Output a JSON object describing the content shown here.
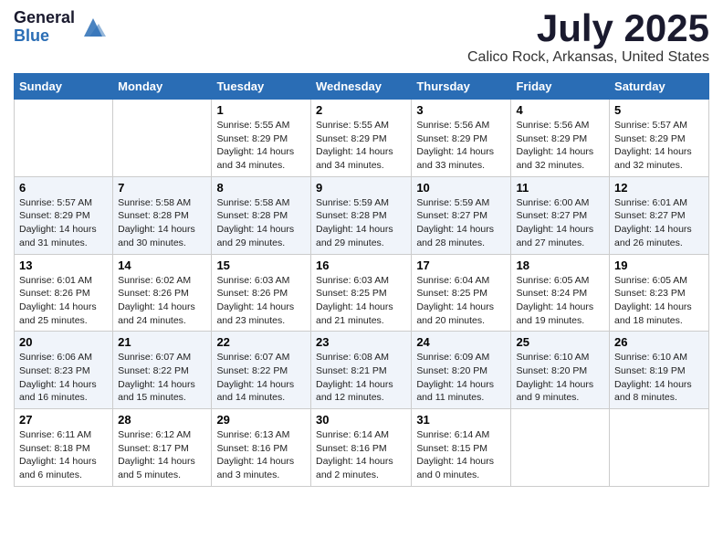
{
  "header": {
    "logo_general": "General",
    "logo_blue": "Blue",
    "month": "July 2025",
    "location": "Calico Rock, Arkansas, United States"
  },
  "days_of_week": [
    "Sunday",
    "Monday",
    "Tuesday",
    "Wednesday",
    "Thursday",
    "Friday",
    "Saturday"
  ],
  "weeks": [
    [
      {
        "day": "",
        "sunrise": "",
        "sunset": "",
        "daylight": "",
        "empty": true
      },
      {
        "day": "",
        "sunrise": "",
        "sunset": "",
        "daylight": "",
        "empty": true
      },
      {
        "day": "1",
        "sunrise": "Sunrise: 5:55 AM",
        "sunset": "Sunset: 8:29 PM",
        "daylight": "Daylight: 14 hours and 34 minutes."
      },
      {
        "day": "2",
        "sunrise": "Sunrise: 5:55 AM",
        "sunset": "Sunset: 8:29 PM",
        "daylight": "Daylight: 14 hours and 34 minutes."
      },
      {
        "day": "3",
        "sunrise": "Sunrise: 5:56 AM",
        "sunset": "Sunset: 8:29 PM",
        "daylight": "Daylight: 14 hours and 33 minutes."
      },
      {
        "day": "4",
        "sunrise": "Sunrise: 5:56 AM",
        "sunset": "Sunset: 8:29 PM",
        "daylight": "Daylight: 14 hours and 32 minutes."
      },
      {
        "day": "5",
        "sunrise": "Sunrise: 5:57 AM",
        "sunset": "Sunset: 8:29 PM",
        "daylight": "Daylight: 14 hours and 32 minutes."
      }
    ],
    [
      {
        "day": "6",
        "sunrise": "Sunrise: 5:57 AM",
        "sunset": "Sunset: 8:29 PM",
        "daylight": "Daylight: 14 hours and 31 minutes."
      },
      {
        "day": "7",
        "sunrise": "Sunrise: 5:58 AM",
        "sunset": "Sunset: 8:28 PM",
        "daylight": "Daylight: 14 hours and 30 minutes."
      },
      {
        "day": "8",
        "sunrise": "Sunrise: 5:58 AM",
        "sunset": "Sunset: 8:28 PM",
        "daylight": "Daylight: 14 hours and 29 minutes."
      },
      {
        "day": "9",
        "sunrise": "Sunrise: 5:59 AM",
        "sunset": "Sunset: 8:28 PM",
        "daylight": "Daylight: 14 hours and 29 minutes."
      },
      {
        "day": "10",
        "sunrise": "Sunrise: 5:59 AM",
        "sunset": "Sunset: 8:27 PM",
        "daylight": "Daylight: 14 hours and 28 minutes."
      },
      {
        "day": "11",
        "sunrise": "Sunrise: 6:00 AM",
        "sunset": "Sunset: 8:27 PM",
        "daylight": "Daylight: 14 hours and 27 minutes."
      },
      {
        "day": "12",
        "sunrise": "Sunrise: 6:01 AM",
        "sunset": "Sunset: 8:27 PM",
        "daylight": "Daylight: 14 hours and 26 minutes."
      }
    ],
    [
      {
        "day": "13",
        "sunrise": "Sunrise: 6:01 AM",
        "sunset": "Sunset: 8:26 PM",
        "daylight": "Daylight: 14 hours and 25 minutes."
      },
      {
        "day": "14",
        "sunrise": "Sunrise: 6:02 AM",
        "sunset": "Sunset: 8:26 PM",
        "daylight": "Daylight: 14 hours and 24 minutes."
      },
      {
        "day": "15",
        "sunrise": "Sunrise: 6:03 AM",
        "sunset": "Sunset: 8:26 PM",
        "daylight": "Daylight: 14 hours and 23 minutes."
      },
      {
        "day": "16",
        "sunrise": "Sunrise: 6:03 AM",
        "sunset": "Sunset: 8:25 PM",
        "daylight": "Daylight: 14 hours and 21 minutes."
      },
      {
        "day": "17",
        "sunrise": "Sunrise: 6:04 AM",
        "sunset": "Sunset: 8:25 PM",
        "daylight": "Daylight: 14 hours and 20 minutes."
      },
      {
        "day": "18",
        "sunrise": "Sunrise: 6:05 AM",
        "sunset": "Sunset: 8:24 PM",
        "daylight": "Daylight: 14 hours and 19 minutes."
      },
      {
        "day": "19",
        "sunrise": "Sunrise: 6:05 AM",
        "sunset": "Sunset: 8:23 PM",
        "daylight": "Daylight: 14 hours and 18 minutes."
      }
    ],
    [
      {
        "day": "20",
        "sunrise": "Sunrise: 6:06 AM",
        "sunset": "Sunset: 8:23 PM",
        "daylight": "Daylight: 14 hours and 16 minutes."
      },
      {
        "day": "21",
        "sunrise": "Sunrise: 6:07 AM",
        "sunset": "Sunset: 8:22 PM",
        "daylight": "Daylight: 14 hours and 15 minutes."
      },
      {
        "day": "22",
        "sunrise": "Sunrise: 6:07 AM",
        "sunset": "Sunset: 8:22 PM",
        "daylight": "Daylight: 14 hours and 14 minutes."
      },
      {
        "day": "23",
        "sunrise": "Sunrise: 6:08 AM",
        "sunset": "Sunset: 8:21 PM",
        "daylight": "Daylight: 14 hours and 12 minutes."
      },
      {
        "day": "24",
        "sunrise": "Sunrise: 6:09 AM",
        "sunset": "Sunset: 8:20 PM",
        "daylight": "Daylight: 14 hours and 11 minutes."
      },
      {
        "day": "25",
        "sunrise": "Sunrise: 6:10 AM",
        "sunset": "Sunset: 8:20 PM",
        "daylight": "Daylight: 14 hours and 9 minutes."
      },
      {
        "day": "26",
        "sunrise": "Sunrise: 6:10 AM",
        "sunset": "Sunset: 8:19 PM",
        "daylight": "Daylight: 14 hours and 8 minutes."
      }
    ],
    [
      {
        "day": "27",
        "sunrise": "Sunrise: 6:11 AM",
        "sunset": "Sunset: 8:18 PM",
        "daylight": "Daylight: 14 hours and 6 minutes."
      },
      {
        "day": "28",
        "sunrise": "Sunrise: 6:12 AM",
        "sunset": "Sunset: 8:17 PM",
        "daylight": "Daylight: 14 hours and 5 minutes."
      },
      {
        "day": "29",
        "sunrise": "Sunrise: 6:13 AM",
        "sunset": "Sunset: 8:16 PM",
        "daylight": "Daylight: 14 hours and 3 minutes."
      },
      {
        "day": "30",
        "sunrise": "Sunrise: 6:14 AM",
        "sunset": "Sunset: 8:16 PM",
        "daylight": "Daylight: 14 hours and 2 minutes."
      },
      {
        "day": "31",
        "sunrise": "Sunrise: 6:14 AM",
        "sunset": "Sunset: 8:15 PM",
        "daylight": "Daylight: 14 hours and 0 minutes."
      },
      {
        "day": "",
        "sunrise": "",
        "sunset": "",
        "daylight": "",
        "empty": true
      },
      {
        "day": "",
        "sunrise": "",
        "sunset": "",
        "daylight": "",
        "empty": true
      }
    ]
  ]
}
